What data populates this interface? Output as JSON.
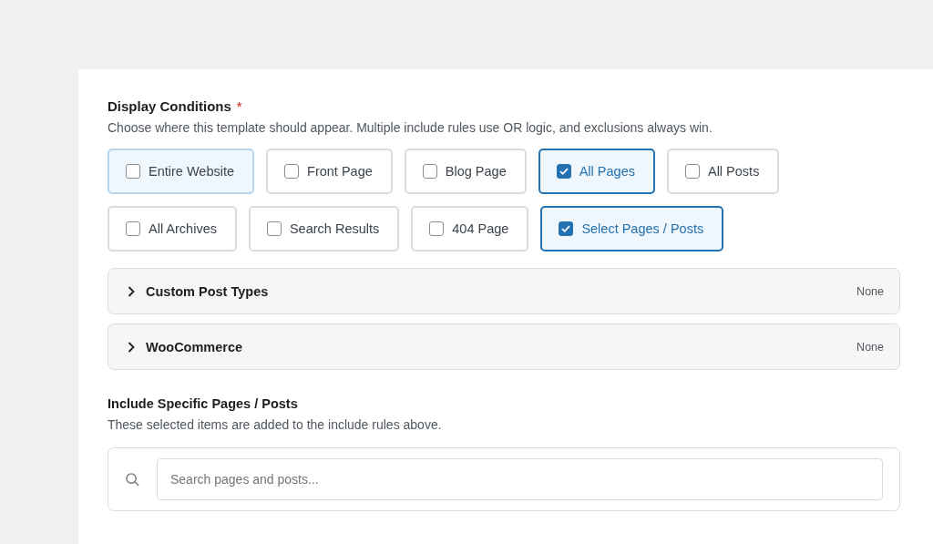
{
  "section": {
    "title": "Display Conditions",
    "required_mark": "*",
    "description": "Choose where this template should appear. Multiple include rules use OR logic, and exclusions always win."
  },
  "options": [
    {
      "label": "Entire Website",
      "checked": false,
      "focused": true
    },
    {
      "label": "Front Page",
      "checked": false,
      "focused": false
    },
    {
      "label": "Blog Page",
      "checked": false,
      "focused": false
    },
    {
      "label": "All Pages",
      "checked": true,
      "focused": false
    },
    {
      "label": "All Posts",
      "checked": false,
      "focused": false
    },
    {
      "label": "All Archives",
      "checked": false,
      "focused": false
    },
    {
      "label": "Search Results",
      "checked": false,
      "focused": false
    },
    {
      "label": "404 Page",
      "checked": false,
      "focused": false
    },
    {
      "label": "Select Pages / Posts",
      "checked": true,
      "focused": false
    }
  ],
  "groups": [
    {
      "label": "Custom Post Types",
      "value": "None",
      "expanded": false
    },
    {
      "label": "WooCommerce",
      "value": "None",
      "expanded": false
    }
  ],
  "include": {
    "title": "Include Specific Pages / Posts",
    "description": "These selected items are added to the include rules above.",
    "search": {
      "placeholder": "Search pages and posts..."
    }
  }
}
